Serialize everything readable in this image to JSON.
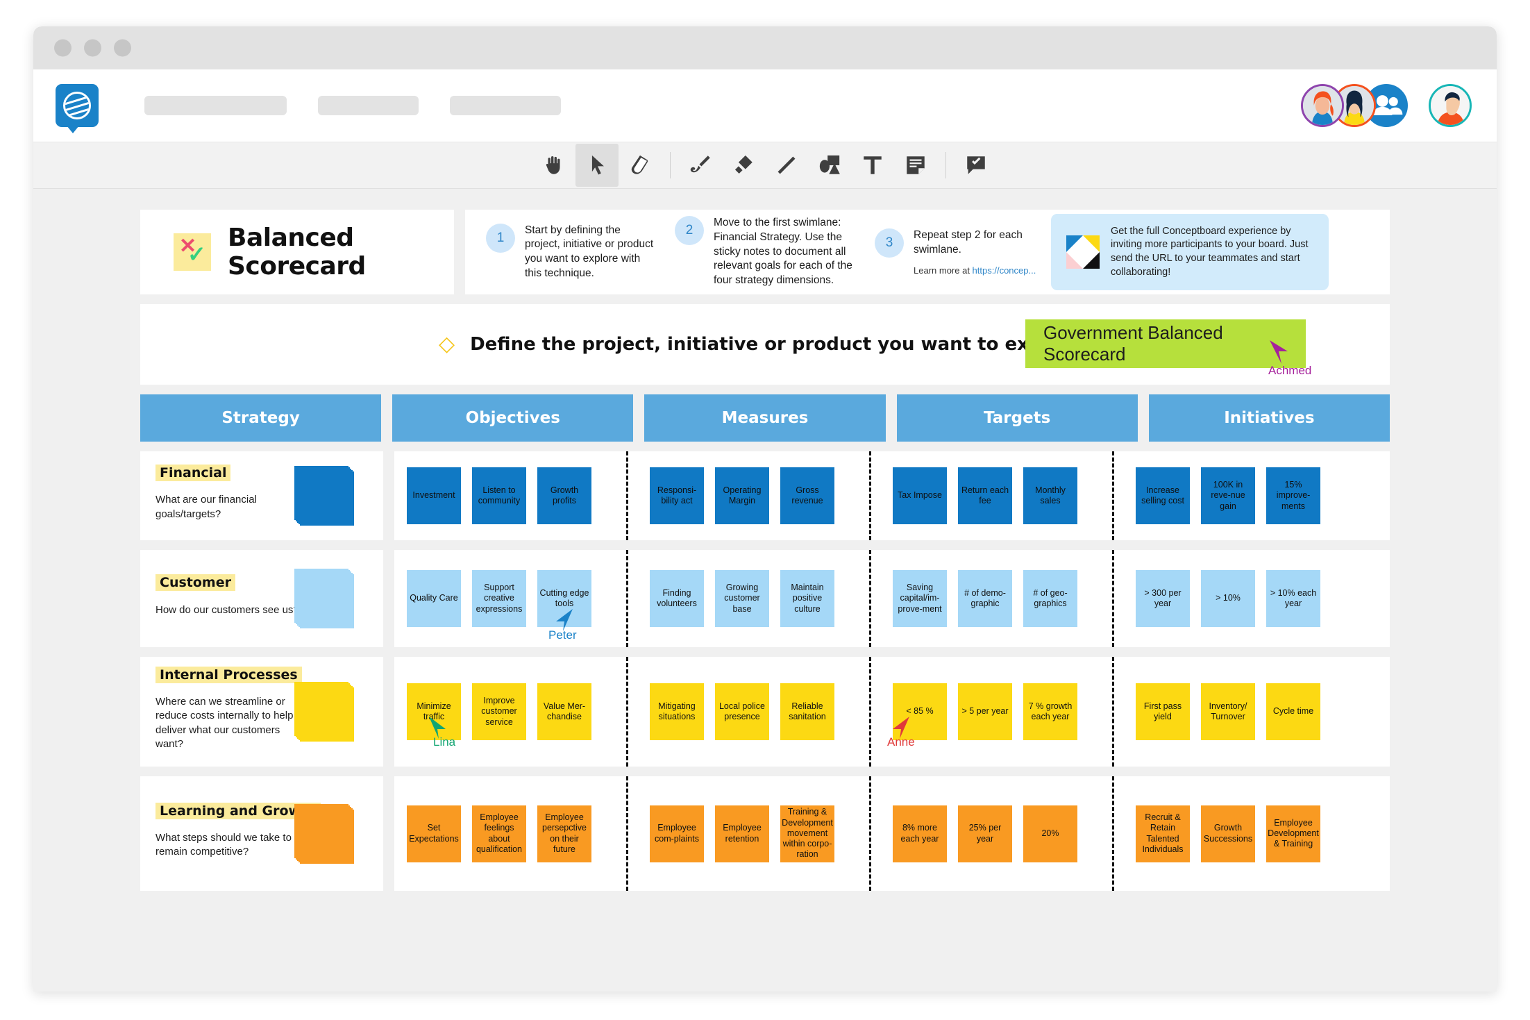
{
  "header": {
    "logo_icon": "conceptboard-logo-icon",
    "placeholders": 3,
    "avatars": [
      "avatar-user-1",
      "avatar-user-2",
      "avatar-group-icon",
      "avatar-current-user"
    ]
  },
  "toolbar": {
    "tools": [
      {
        "name": "hand-tool",
        "label": "Hand",
        "active": false
      },
      {
        "name": "select-tool",
        "label": "Select",
        "active": true
      },
      {
        "name": "eraser-tool",
        "label": "Eraser",
        "active": false
      },
      {
        "name": "pen-tool",
        "label": "Pen",
        "active": false
      },
      {
        "name": "highlighter-tool",
        "label": "Highlighter",
        "active": false
      },
      {
        "name": "line-tool",
        "label": "Line",
        "active": false
      },
      {
        "name": "shapes-tool",
        "label": "Shapes",
        "active": false
      },
      {
        "name": "text-tool",
        "label": "Text",
        "active": false
      },
      {
        "name": "sticky-note-tool",
        "label": "Sticky note",
        "active": false
      },
      {
        "name": "comment-tool",
        "label": "Comment",
        "active": false
      }
    ]
  },
  "board": {
    "title": "Balanced Scorecard",
    "title_icon": "checklist-sticky-icon",
    "steps": [
      {
        "num": "1",
        "text": "Start by defining the project, initiative or product you want to explore with this technique."
      },
      {
        "num": "2",
        "text": "Move to the first swimlane: Financial Strategy. Use the sticky notes to document all relevant goals for each of the four strategy dimensions."
      },
      {
        "num": "3",
        "text": "Repeat step 2 for each swimlane.",
        "sub_prefix": "Learn more at ",
        "sub_link": "https://concep..."
      }
    ],
    "promo": {
      "icon": "conceptboard-mark-icon",
      "text": "Get the full Conceptboard experience by inviting more participants to your board. Just send the URL to your teammates and start collaborating!"
    },
    "define": {
      "bullet_icon": "diamond-icon",
      "prompt": "Define the project, initiative or product you want to explore.",
      "answer": "Government Balanced Scorecard",
      "cursor_name": "Achmed",
      "cursor_color": "#a5229b"
    },
    "columns": [
      "Strategy",
      "Objectives",
      "Measures",
      "Targets",
      "Initiatives"
    ],
    "lanes": [
      {
        "name": "Financial",
        "question": "What are our financial goals/targets?",
        "color": "#1079c4",
        "objectives": [
          "Investment",
          "Listen to community",
          "Growth profits"
        ],
        "measures": [
          "Responsi-bility act",
          "Operating Margin",
          "Gross revenue"
        ],
        "targets": [
          "Tax Impose",
          "Return each fee",
          "Monthly sales"
        ],
        "initiatives": [
          "Increase selling cost",
          "100K in reve-nue gain",
          "15% improve-ments"
        ]
      },
      {
        "name": "Customer",
        "question": "How do our customers see us?",
        "color": "#a5d8f7",
        "objectives": [
          "Quality Care",
          "Support creative expressions",
          "Cutting edge tools"
        ],
        "measures": [
          "Finding volunteers",
          "Growing customer base",
          "Maintain positive culture"
        ],
        "targets": [
          "Saving capital/im-prove-ment",
          "# of demo-graphic",
          "# of geo-graphics"
        ],
        "initiatives": [
          "> 300 per year",
          "> 10%",
          "> 10% each year"
        ],
        "cursor_name": "Peter",
        "cursor_color": "#1a82c8"
      },
      {
        "name": "Internal Processes",
        "question": "Where can we streamline or reduce costs internally to help deliver what our customers want?",
        "color": "#fcd913",
        "objectives": [
          "Minimize traffic",
          "Improve customer service",
          "Value Mer-chandise"
        ],
        "measures": [
          "Mitigating situations",
          "Local police presence",
          "Reliable sanitation"
        ],
        "targets": [
          "< 85 %",
          "> 5 per year",
          "7 % growth each year"
        ],
        "initiatives": [
          "First pass yield",
          "Inventory/ Turnover",
          "Cycle time"
        ],
        "cursor_name": "Lina",
        "cursor_color": "#12a572",
        "cursor2_name": "Anne",
        "cursor2_color": "#e03a3a"
      },
      {
        "name": "Learning and Growth",
        "question": "What steps should we take to remain competitive?",
        "color": "#f99a22",
        "objectives": [
          "Set Expectations",
          "Employee feelings about qualification",
          "Employee persepctive on their future"
        ],
        "measures": [
          "Employee com-plaints",
          "Employee retention",
          "Training & Development movement within corpo-ration"
        ],
        "targets": [
          "8% more each year",
          "25% per year",
          "20%"
        ],
        "initiatives": [
          "Recruit & Retain Talented Individuals",
          "Growth Successions",
          "Employee Development & Training"
        ]
      }
    ]
  }
}
